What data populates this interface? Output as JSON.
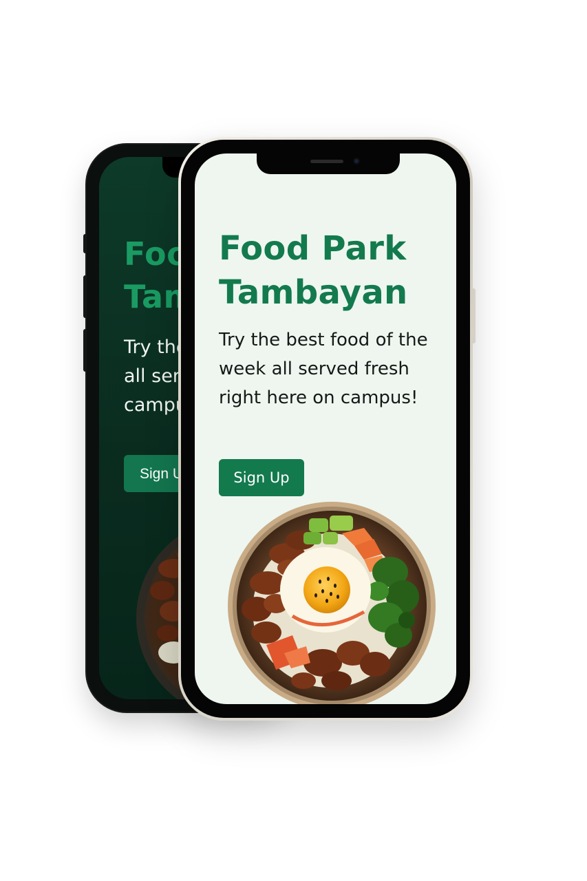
{
  "colors": {
    "brand_green": "#137a4e",
    "light_screen_bg": "#eef6ef",
    "dark_screen_bg": "#0a2c1f",
    "button_text": "#ffffff"
  },
  "back_phone": {
    "theme": "dark",
    "title": "Food Park Tambayan",
    "tagline": "Try the best food of the week all served fresh right here on campus!",
    "signup_label": "Sign Up",
    "hero_image": "rice-bowl-with-egg-image"
  },
  "front_phone": {
    "theme": "light",
    "title": "Food Park Tambayan",
    "tagline": "Try the best food of the week all served fresh right here on campus!",
    "signup_label": "Sign Up",
    "hero_image": "rice-bowl-with-egg-image"
  }
}
